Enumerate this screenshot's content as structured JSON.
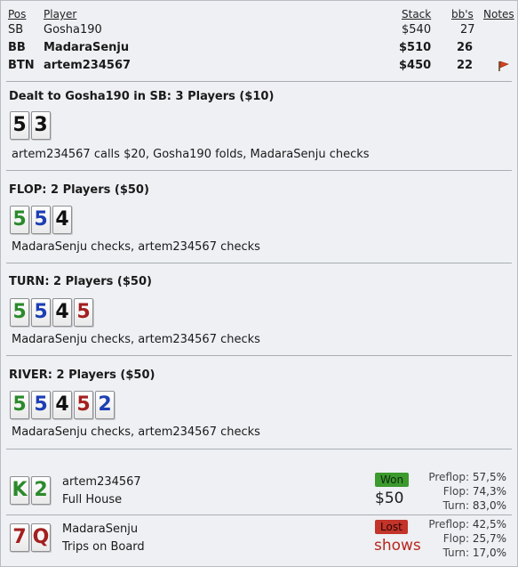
{
  "header": {
    "col_pos": "Pos",
    "col_player": "Player",
    "col_stack": "Stack",
    "col_bbs": "bb's",
    "col_notes": "Notes"
  },
  "players": [
    {
      "pos": "SB",
      "name": "Gosha190",
      "stack": "$540",
      "bbs": "27",
      "bold": false
    },
    {
      "pos": "BB",
      "name": "MadaraSenju",
      "stack": "$510",
      "bbs": "26",
      "bold": true
    },
    {
      "pos": "BTN",
      "name": "artem234567",
      "stack": "$450",
      "bbs": "22",
      "bold": true
    }
  ],
  "notes_icon": "flag-icon",
  "preflop": {
    "title": "Dealt to Gosha190 in SB: 3 Players ($10)",
    "cards": [
      {
        "rank": "5",
        "suit": "s"
      },
      {
        "rank": "3",
        "suit": "s"
      }
    ],
    "action": "artem234567 calls $20, Gosha190 folds, MadaraSenju checks"
  },
  "flop": {
    "title": "FLOP: 2 Players ($50)",
    "cards": [
      {
        "rank": "5",
        "suit": "c"
      },
      {
        "rank": "5",
        "suit": "d"
      },
      {
        "rank": "4",
        "suit": "s"
      }
    ],
    "action": "MadaraSenju checks, artem234567 checks"
  },
  "turn": {
    "title": "TURN: 2 Players ($50)",
    "cards": [
      {
        "rank": "5",
        "suit": "c"
      },
      {
        "rank": "5",
        "suit": "d"
      },
      {
        "rank": "4",
        "suit": "s"
      },
      {
        "rank": "5",
        "suit": "h"
      }
    ],
    "action": "MadaraSenju checks, artem234567 checks"
  },
  "river": {
    "title": "RIVER: 2 Players ($50)",
    "cards": [
      {
        "rank": "5",
        "suit": "c"
      },
      {
        "rank": "5",
        "suit": "d"
      },
      {
        "rank": "4",
        "suit": "s"
      },
      {
        "rank": "5",
        "suit": "h"
      },
      {
        "rank": "2",
        "suit": "d"
      }
    ],
    "action": "MadaraSenju checks, artem234567 checks"
  },
  "showdown": [
    {
      "cards": [
        {
          "rank": "K",
          "suit": "c"
        },
        {
          "rank": "2",
          "suit": "c"
        }
      ],
      "name": "artem234567",
      "hand": "Full House",
      "result": "Won",
      "result_type": "won",
      "amount": "$50",
      "stats": [
        {
          "label": "Preflop:",
          "value": "57,5%"
        },
        {
          "label": "Flop:",
          "value": "74,3%"
        },
        {
          "label": "Turn:",
          "value": "83,0%"
        }
      ]
    },
    {
      "cards": [
        {
          "rank": "7",
          "suit": "h"
        },
        {
          "rank": "Q",
          "suit": "h"
        }
      ],
      "name": "MadaraSenju",
      "hand": "Trips on Board",
      "result": "Lost",
      "result_type": "lost",
      "amount": "shows",
      "stats": [
        {
          "label": "Preflop:",
          "value": "42,5%"
        },
        {
          "label": "Flop:",
          "value": "25,7%"
        },
        {
          "label": "Turn:",
          "value": "17,0%"
        }
      ]
    }
  ],
  "colors": {
    "clubs": "#2b8a2b",
    "diamonds": "#1d3fb4",
    "spades": "#111111",
    "hearts": "#a3201f",
    "won": "#3c9a2e",
    "lost": "#c3342a"
  }
}
